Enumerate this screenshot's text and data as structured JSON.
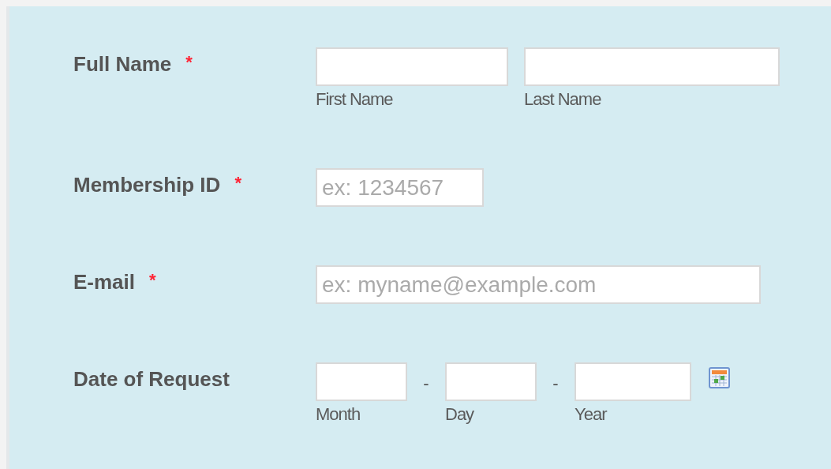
{
  "fields": [
    {
      "kind": "name",
      "label": "Full Name",
      "required": true,
      "required_mark": "*",
      "inputs": [
        {
          "sublabel": "First Name"
        },
        {
          "sublabel": "Last Name"
        }
      ]
    },
    {
      "kind": "number",
      "label": "Membership ID",
      "required": true,
      "required_mark": "*",
      "placeholder": "ex: 1234567"
    },
    {
      "kind": "email",
      "label": "E-mail",
      "required": true,
      "required_mark": "*",
      "placeholder": "ex: myname@example.com"
    },
    {
      "kind": "date",
      "label": "Date of Request",
      "required": false,
      "separator": "-",
      "inputs": [
        {
          "sublabel": "Month"
        },
        {
          "sublabel": "Day"
        },
        {
          "sublabel": "Year"
        }
      ]
    }
  ]
}
